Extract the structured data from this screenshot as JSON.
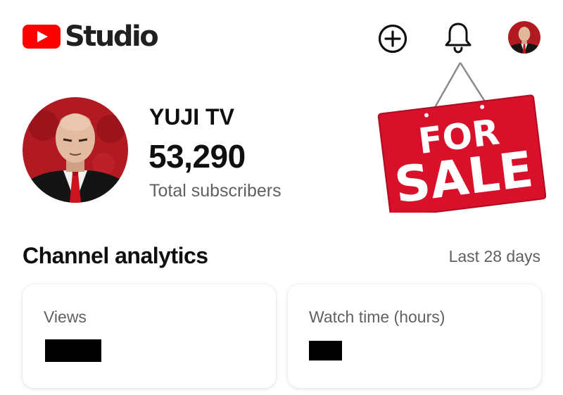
{
  "header": {
    "logo_text": "Studio",
    "logo_icon": "youtube-play-icon",
    "create_icon": "plus-circle-icon",
    "notifications_icon": "bell-icon",
    "brand_color": "#ff0000"
  },
  "channel": {
    "name": "YUJI TV",
    "subscriber_count": "53,290",
    "subscriber_label": "Total subscribers"
  },
  "sale_sign": {
    "line1": "FOR",
    "line2": "SALE",
    "color": "#d8102a"
  },
  "analytics": {
    "title": "Channel analytics",
    "period": "Last 28 days",
    "cards": [
      {
        "label": "Views"
      },
      {
        "label": "Watch time (hours)"
      }
    ]
  }
}
